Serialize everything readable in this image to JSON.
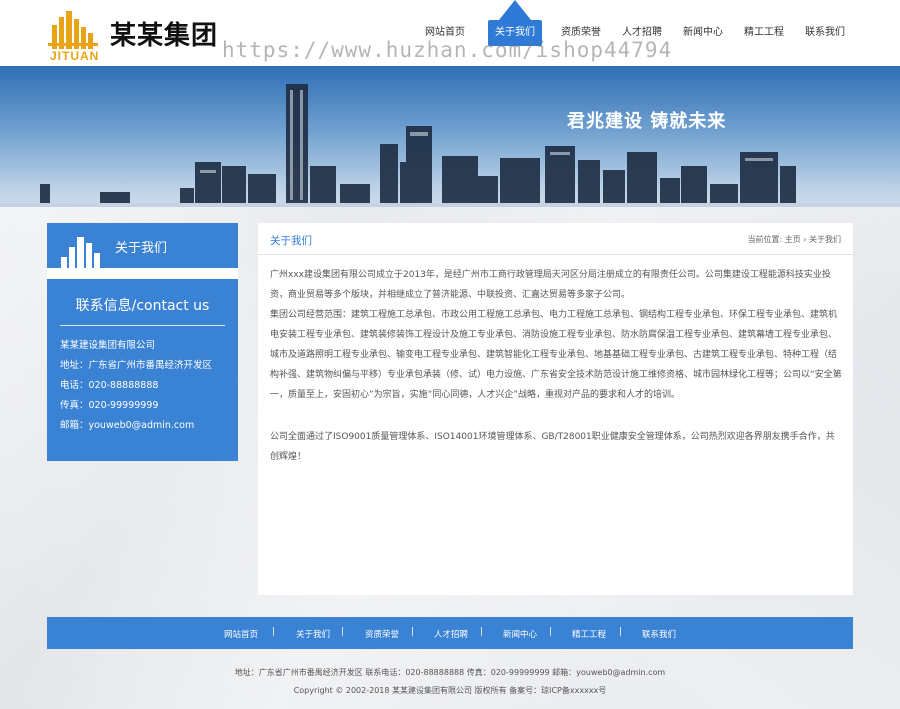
{
  "header": {
    "logo_sub": "JITUAN",
    "logo_name": "某某集团",
    "watermark": "https://www.huzhan.com/ishop44794",
    "brand_color": "#2e7ad6",
    "nav": [
      {
        "label": "网站首页"
      },
      {
        "label": "关于我们",
        "active": true
      },
      {
        "label": "资质荣誉"
      },
      {
        "label": "人才招聘"
      },
      {
        "label": "新闻中心"
      },
      {
        "label": "精工工程"
      },
      {
        "label": "联系我们"
      }
    ]
  },
  "banner": {
    "slogan": "君兆建设  铸就未来"
  },
  "sidebar": {
    "title": "关于我们",
    "contact_title": "联系信息/contact us",
    "company": "某某建设集团有限公司",
    "address": "地址：广东省广州市番禺经济开发区",
    "phone": "电话：020-88888888",
    "fax": "传真：020-99999999",
    "email": "邮箱：youweb0@admin.com"
  },
  "content": {
    "title": "关于我们",
    "breadcrumb_label": "当前位置:",
    "breadcrumb_home": "主页",
    "breadcrumb_sep": "›",
    "breadcrumb_current": "关于我们",
    "p1": "广州xxx建设集团有限公司成立于2013年，是经广州市工商行政管理局天河区分局注册成立的有限责任公司。公司集建设工程能源科技实业投资，商业贸易等多个版块，并相继成立了普济能源、中联投资、汇嘉达贸易等多家子公司。",
    "p2": "集团公司经营范围：建筑工程施工总承包、市政公用工程施工总承包、电力工程施工总承包、钢结构工程专业承包、环保工程专业承包、建筑机电安装工程专业承包、建筑装修装饰工程设计及施工专业承包、消防设施工程专业承包、防水防腐保温工程专业承包、建筑幕墙工程专业承包、城市及道路照明工程专业承包、输变电工程专业承包、建筑智能化工程专业承包、地基基础工程专业承包、古建筑工程专业承包、特种工程（结构补强、建筑物纠偏与平移）专业承包承装（修、试）电力设施、广东省安全技术防范设计施工维修资格、城市园林绿化工程等；公司以“安全第一，质量至上，安固初心”为宗旨，实施“同心同德，人才兴企”战略，重视对产品的要求和人才的培训。",
    "p3": "公司全面通过了ISO9001质量管理体系、ISO14001环境管理体系、GB/T28001职业健康安全管理体系，公司热烈欢迎各界朋友携手合作，共创辉煌！"
  },
  "footer": {
    "nav": [
      "网站首页",
      "关于我们",
      "资质荣誉",
      "人才招聘",
      "新闻中心",
      "精工工程",
      "联系我们"
    ],
    "separator": "|",
    "contact": "地址：广东省广州市番禺经济开发区  联系电话：020-88888888  传真：020-99999999  邮箱：youweb0@admin.com",
    "copyright": "Copyright © 2002-2018 某某建设集团有限公司 版权所有      备案号：琼ICP备xxxxxx号"
  }
}
